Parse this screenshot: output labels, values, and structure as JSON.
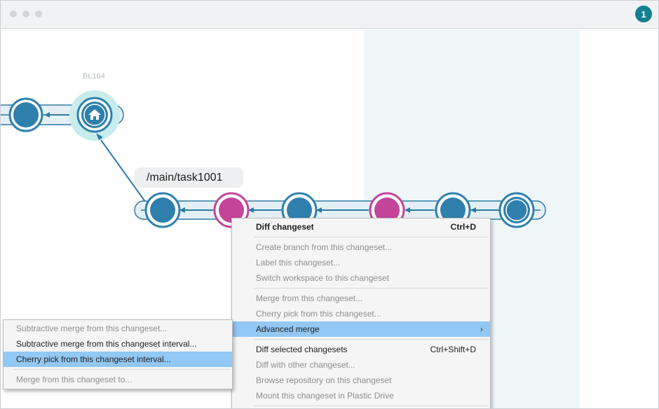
{
  "titlebar": {
    "notification_count": "1"
  },
  "graph": {
    "label_name": "BL104",
    "branch_name": "/main/task1001",
    "colors": {
      "changeset": "#2f80ad",
      "merge_changeset": "#c4449a",
      "branch_line": "#2d7aa6",
      "label_ring": "#c7eceb",
      "highlight_column": "#eff7f9"
    }
  },
  "context_menu": {
    "items": [
      {
        "label": "Diff changeset",
        "shortcut": "Ctrl+D"
      },
      {
        "label": "Create branch from this changeset..."
      },
      {
        "label": "Label this changeset..."
      },
      {
        "label": "Switch workspace to this changeset"
      },
      {
        "label": "Merge from this changeset..."
      },
      {
        "label": "Cherry pick from this changeset..."
      },
      {
        "label": "Advanced merge",
        "submenu_indicator": "›"
      },
      {
        "label": "Diff selected changesets",
        "shortcut": "Ctrl+Shift+D"
      },
      {
        "label": "Diff with other changeset..."
      },
      {
        "label": "Browse repository on this changeset"
      },
      {
        "label": "Mount this changeset in Plastic Drive"
      }
    ]
  },
  "submenu": {
    "items": [
      {
        "label": "Subtractive merge from this changeset..."
      },
      {
        "label": "Subtractive merge from this changeset interval..."
      },
      {
        "label": "Cherry pick from this changeset interval..."
      },
      {
        "label": "Merge from this changeset to..."
      }
    ]
  }
}
